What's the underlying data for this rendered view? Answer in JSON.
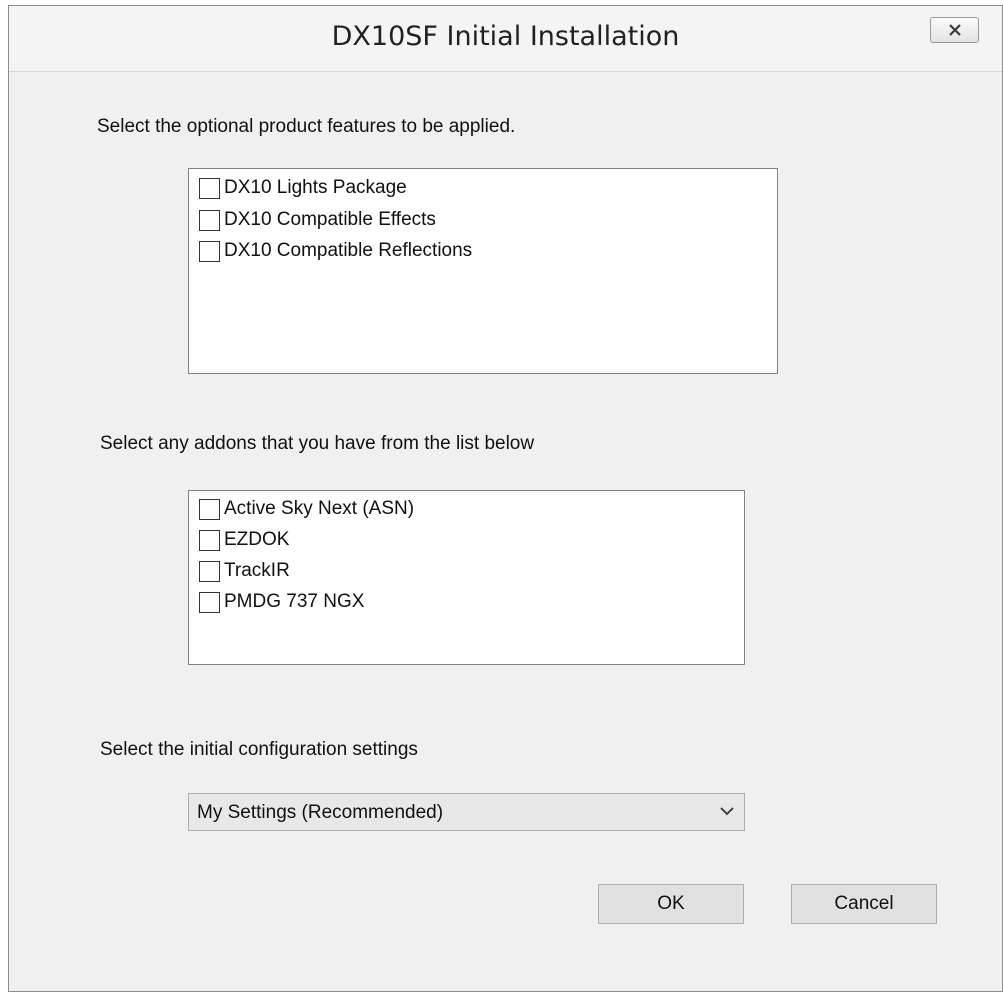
{
  "window": {
    "title": "DX10SF Initial Installation",
    "close_icon": "close-x-icon"
  },
  "features": {
    "label": "Select the optional product features to be applied.",
    "items": [
      {
        "label": "DX10 Lights Package",
        "checked": false
      },
      {
        "label": "DX10 Compatible Effects",
        "checked": false
      },
      {
        "label": "DX10 Compatible Reflections",
        "checked": false
      }
    ]
  },
  "addons": {
    "label": "Select any addons that you have from the list below",
    "items": [
      {
        "label": "Active Sky Next (ASN)",
        "checked": false
      },
      {
        "label": "EZDOK",
        "checked": false
      },
      {
        "label": "TrackIR",
        "checked": false
      },
      {
        "label": "PMDG 737 NGX",
        "checked": false
      }
    ]
  },
  "config": {
    "label": "Select the initial configuration settings",
    "selected": "My Settings (Recommended)"
  },
  "buttons": {
    "ok": "OK",
    "cancel": "Cancel"
  }
}
